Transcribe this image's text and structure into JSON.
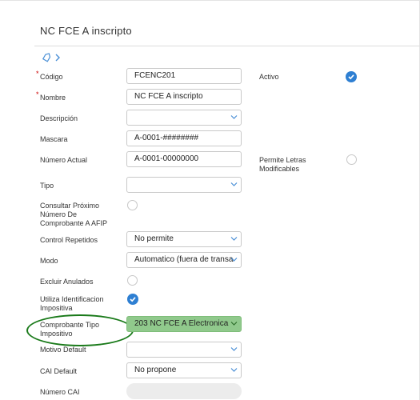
{
  "page": {
    "title": "NC FCE A inscripto"
  },
  "icons": {
    "tag": "tag-icon",
    "back": "chevron-right-icon"
  },
  "colors": {
    "accent": "#2e7fd2",
    "highlight": "#90c98c",
    "annotation": "#1a7a1a",
    "required": "#cc0000"
  },
  "form": {
    "required_mark": "*",
    "codigo": {
      "label": "Código",
      "value": "FCENC201"
    },
    "nombre": {
      "label": "Nombre",
      "value": "NC FCE A  inscripto"
    },
    "descripcion": {
      "label": "Descripción",
      "value": ""
    },
    "mascara": {
      "label": "Mascara",
      "value": "A-0001-########"
    },
    "numero_actual": {
      "label": "Número Actual",
      "value": "A-0001-00000000"
    },
    "tipo": {
      "label": "Tipo",
      "value": ""
    },
    "consultar": {
      "label": "Consultar Próximo Número De Comprobante A AFIP",
      "checked": false
    },
    "control_repetidos": {
      "label": "Control Repetidos",
      "value": "No permite"
    },
    "modo": {
      "label": "Modo",
      "value": "Automatico (fuera de transac"
    },
    "excluir_anulados": {
      "label": "Excluir Anulados",
      "checked": false
    },
    "utiliza_identificacion": {
      "label": "Utiliza Identificacion Impositiva",
      "checked": true
    },
    "comprobante_tipo": {
      "label": "Comprobante Tipo Impositivo",
      "value": "203 NC FCE A Electronica"
    },
    "motivo_default": {
      "label": "Motivo Default",
      "value": ""
    },
    "cai_default": {
      "label": "CAI Default",
      "value": "No propone"
    },
    "numero_cai": {
      "label": "Número CAI",
      "value": ""
    },
    "activo": {
      "label": "Activo",
      "checked": true
    },
    "permite_letras": {
      "label": "Permite Letras Modificables",
      "checked": false
    }
  }
}
